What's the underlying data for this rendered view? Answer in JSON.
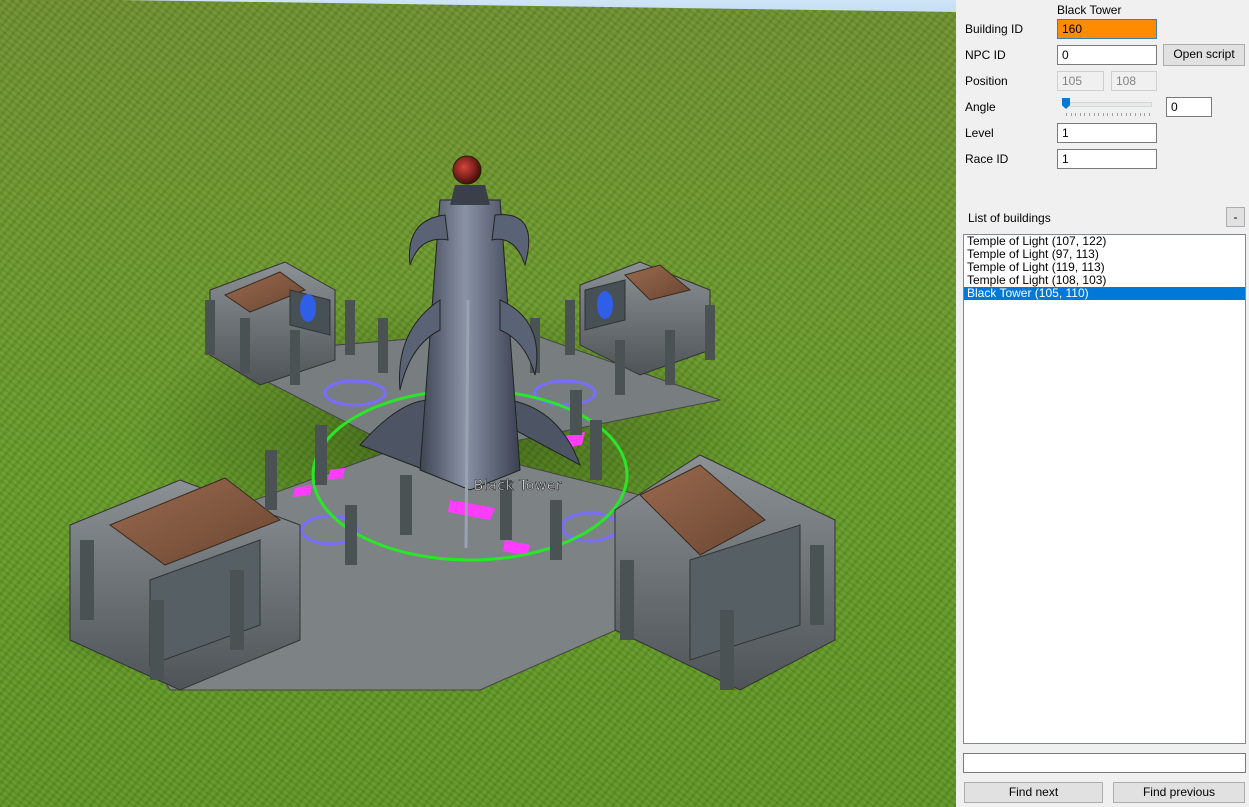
{
  "viewport": {
    "building_label": "Black Tower"
  },
  "panel": {
    "title": "Black Tower",
    "building_id_label": "Building ID",
    "building_id_value": "160",
    "npc_id_label": "NPC ID",
    "npc_id_value": "0",
    "open_script_label": "Open script",
    "position_label": "Position",
    "position_x": "105",
    "position_y": "108",
    "angle_label": "Angle",
    "angle_value": "0",
    "level_label": "Level",
    "level_value": "1",
    "race_id_label": "Race ID",
    "race_id_value": "1",
    "list_title": "List of buildings",
    "collapse_label": "-",
    "buildings": [
      "Temple of Light (107, 122)",
      "Temple of Light (97, 113)",
      "Temple of Light (119, 113)",
      "Temple of Light (108, 103)",
      "Black Tower (105, 110)"
    ],
    "selected_index": 4,
    "search_value": "",
    "find_next_label": "Find next",
    "find_previous_label": "Find previous",
    "accent_color": "#0078d7",
    "highlight_color": "#ff8c00"
  }
}
